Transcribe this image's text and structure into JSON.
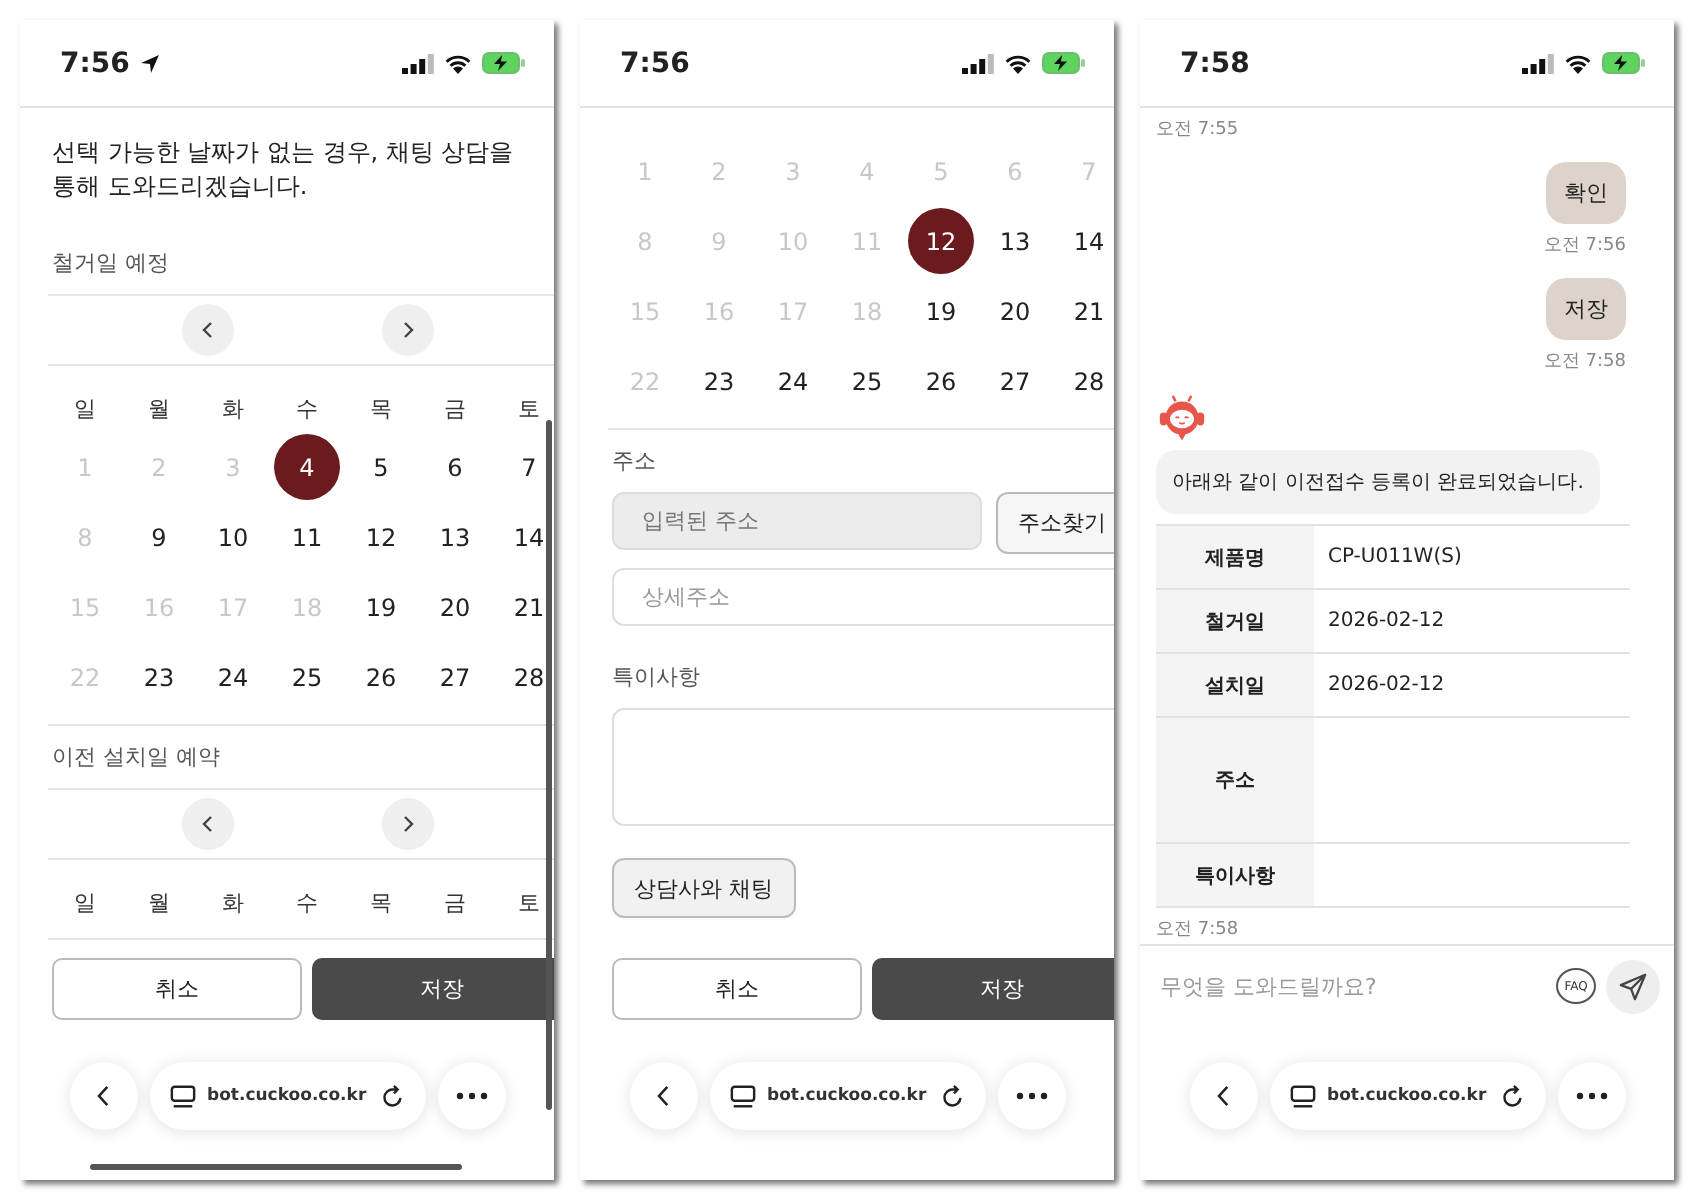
{
  "phones": [
    {
      "status": {
        "time": "7:56",
        "location": true
      },
      "scrollbar": true,
      "home_indicator": true,
      "blocks": [
        {
          "kind": "paragraph",
          "text": "선택 가능한 날짜가 없는 경우, 채팅 상담을 통해 도와드리겠습니다."
        },
        {
          "kind": "label",
          "text": "철거일 예정"
        },
        {
          "kind": "calendar",
          "nav": true,
          "weekdays": [
            "일",
            "월",
            "화",
            "수",
            "목",
            "금",
            "토"
          ],
          "days": [
            {
              "label": "1",
              "disabled": true,
              "selected": false
            },
            {
              "label": "2",
              "disabled": true,
              "selected": false
            },
            {
              "label": "3",
              "disabled": true,
              "selected": false
            },
            {
              "label": "4",
              "disabled": false,
              "selected": true
            },
            {
              "label": "5",
              "disabled": false,
              "selected": false
            },
            {
              "label": "6",
              "disabled": false,
              "selected": false
            },
            {
              "label": "7",
              "disabled": false,
              "selected": false
            },
            {
              "label": "8",
              "disabled": true,
              "selected": false
            },
            {
              "label": "9",
              "disabled": false,
              "selected": false
            },
            {
              "label": "10",
              "disabled": false,
              "selected": false
            },
            {
              "label": "11",
              "disabled": false,
              "selected": false
            },
            {
              "label": "12",
              "disabled": false,
              "selected": false
            },
            {
              "label": "13",
              "disabled": false,
              "selected": false
            },
            {
              "label": "14",
              "disabled": false,
              "selected": false
            },
            {
              "label": "15",
              "disabled": true,
              "selected": false
            },
            {
              "label": "16",
              "disabled": true,
              "selected": false
            },
            {
              "label": "17",
              "disabled": true,
              "selected": false
            },
            {
              "label": "18",
              "disabled": true,
              "selected": false
            },
            {
              "label": "19",
              "disabled": false,
              "selected": false
            },
            {
              "label": "20",
              "disabled": false,
              "selected": false
            },
            {
              "label": "21",
              "disabled": false,
              "selected": false
            },
            {
              "label": "22",
              "disabled": true,
              "selected": false
            },
            {
              "label": "23",
              "disabled": false,
              "selected": false
            },
            {
              "label": "24",
              "disabled": false,
              "selected": false
            },
            {
              "label": "25",
              "disabled": false,
              "selected": false
            },
            {
              "label": "26",
              "disabled": false,
              "selected": false
            },
            {
              "label": "27",
              "disabled": false,
              "selected": false
            },
            {
              "label": "28",
              "disabled": false,
              "selected": false
            }
          ]
        },
        {
          "kind": "label",
          "text": "이전 설치일 예약"
        },
        {
          "kind": "calendar",
          "nav": true,
          "weekdays": [
            "일",
            "월",
            "화",
            "수",
            "목",
            "금",
            "토"
          ]
        }
      ],
      "actions": [
        {
          "label": "취소",
          "primary": false
        },
        {
          "label": "저장",
          "primary": true
        }
      ],
      "browser": {
        "url": "bot.cuckoo.co.kr"
      }
    },
    {
      "status": {
        "time": "7:56",
        "location": false
      },
      "scrollbar": false,
      "home_indicator": false,
      "blocks": [
        {
          "kind": "calendar",
          "nav": false,
          "days": [
            {
              "label": "1",
              "disabled": true,
              "selected": false
            },
            {
              "label": "2",
              "disabled": true,
              "selected": false
            },
            {
              "label": "3",
              "disabled": true,
              "selected": false
            },
            {
              "label": "4",
              "disabled": true,
              "selected": false
            },
            {
              "label": "5",
              "disabled": true,
              "selected": false
            },
            {
              "label": "6",
              "disabled": true,
              "selected": false
            },
            {
              "label": "7",
              "disabled": true,
              "selected": false
            },
            {
              "label": "8",
              "disabled": true,
              "selected": false
            },
            {
              "label": "9",
              "disabled": true,
              "selected": false
            },
            {
              "label": "10",
              "disabled": true,
              "selected": false
            },
            {
              "label": "11",
              "disabled": true,
              "selected": false
            },
            {
              "label": "12",
              "disabled": false,
              "selected": true
            },
            {
              "label": "13",
              "disabled": false,
              "selected": false
            },
            {
              "label": "14",
              "disabled": false,
              "selected": false
            },
            {
              "label": "15",
              "disabled": true,
              "selected": false
            },
            {
              "label": "16",
              "disabled": true,
              "selected": false
            },
            {
              "label": "17",
              "disabled": true,
              "selected": false
            },
            {
              "label": "18",
              "disabled": true,
              "selected": false
            },
            {
              "label": "19",
              "disabled": false,
              "selected": false
            },
            {
              "label": "20",
              "disabled": false,
              "selected": false
            },
            {
              "label": "21",
              "disabled": false,
              "selected": false
            },
            {
              "label": "22",
              "disabled": true,
              "selected": false
            },
            {
              "label": "23",
              "disabled": false,
              "selected": false
            },
            {
              "label": "24",
              "disabled": false,
              "selected": false
            },
            {
              "label": "25",
              "disabled": false,
              "selected": false
            },
            {
              "label": "26",
              "disabled": false,
              "selected": false
            },
            {
              "label": "27",
              "disabled": false,
              "selected": false
            },
            {
              "label": "28",
              "disabled": false,
              "selected": false
            }
          ]
        },
        {
          "kind": "label",
          "text": "주소"
        },
        {
          "kind": "address",
          "placeholder": "입력된 주소",
          "button": "주소찾기"
        },
        {
          "kind": "field",
          "placeholder": "상세주소"
        },
        {
          "kind": "label",
          "text": "특이사항"
        },
        {
          "kind": "textarea"
        },
        {
          "kind": "button",
          "text": "상담사와 채팅"
        }
      ],
      "actions": [
        {
          "label": "취소",
          "primary": false
        },
        {
          "label": "저장",
          "primary": true
        }
      ],
      "browser": {
        "url": "bot.cuckoo.co.kr"
      }
    },
    {
      "status": {
        "time": "7:58",
        "location": false
      },
      "scrollbar": false,
      "home_indicator": false,
      "blocks": [
        {
          "kind": "bot_time",
          "text": "오전 7:55"
        },
        {
          "kind": "user",
          "text": "확인"
        },
        {
          "kind": "user_time",
          "text": "오전 7:56"
        },
        {
          "kind": "user",
          "text": "저장"
        },
        {
          "kind": "user_time",
          "text": "오전 7:58"
        },
        {
          "kind": "avatar"
        },
        {
          "kind": "bot",
          "text": "아래와 같이 이전접수 등록이 완료되었습니다."
        },
        {
          "kind": "table",
          "rows": [
            {
              "label": "제품명",
              "value": "CP-U011W(S)",
              "tall": false
            },
            {
              "label": "철거일",
              "value": "2026-02-12",
              "tall": false
            },
            {
              "label": "설치일",
              "value": "2026-02-12",
              "tall": false
            },
            {
              "label": "주소",
              "tall": true
            },
            {
              "label": "특이사항",
              "tall": false
            }
          ]
        },
        {
          "kind": "bot_time",
          "text": "오전 7:58"
        }
      ],
      "composer": {
        "placeholder": "무엇을 도와드릴까요?",
        "faq": "FAQ"
      },
      "browser": {
        "url": "bot.cuckoo.co.kr"
      }
    }
  ]
}
